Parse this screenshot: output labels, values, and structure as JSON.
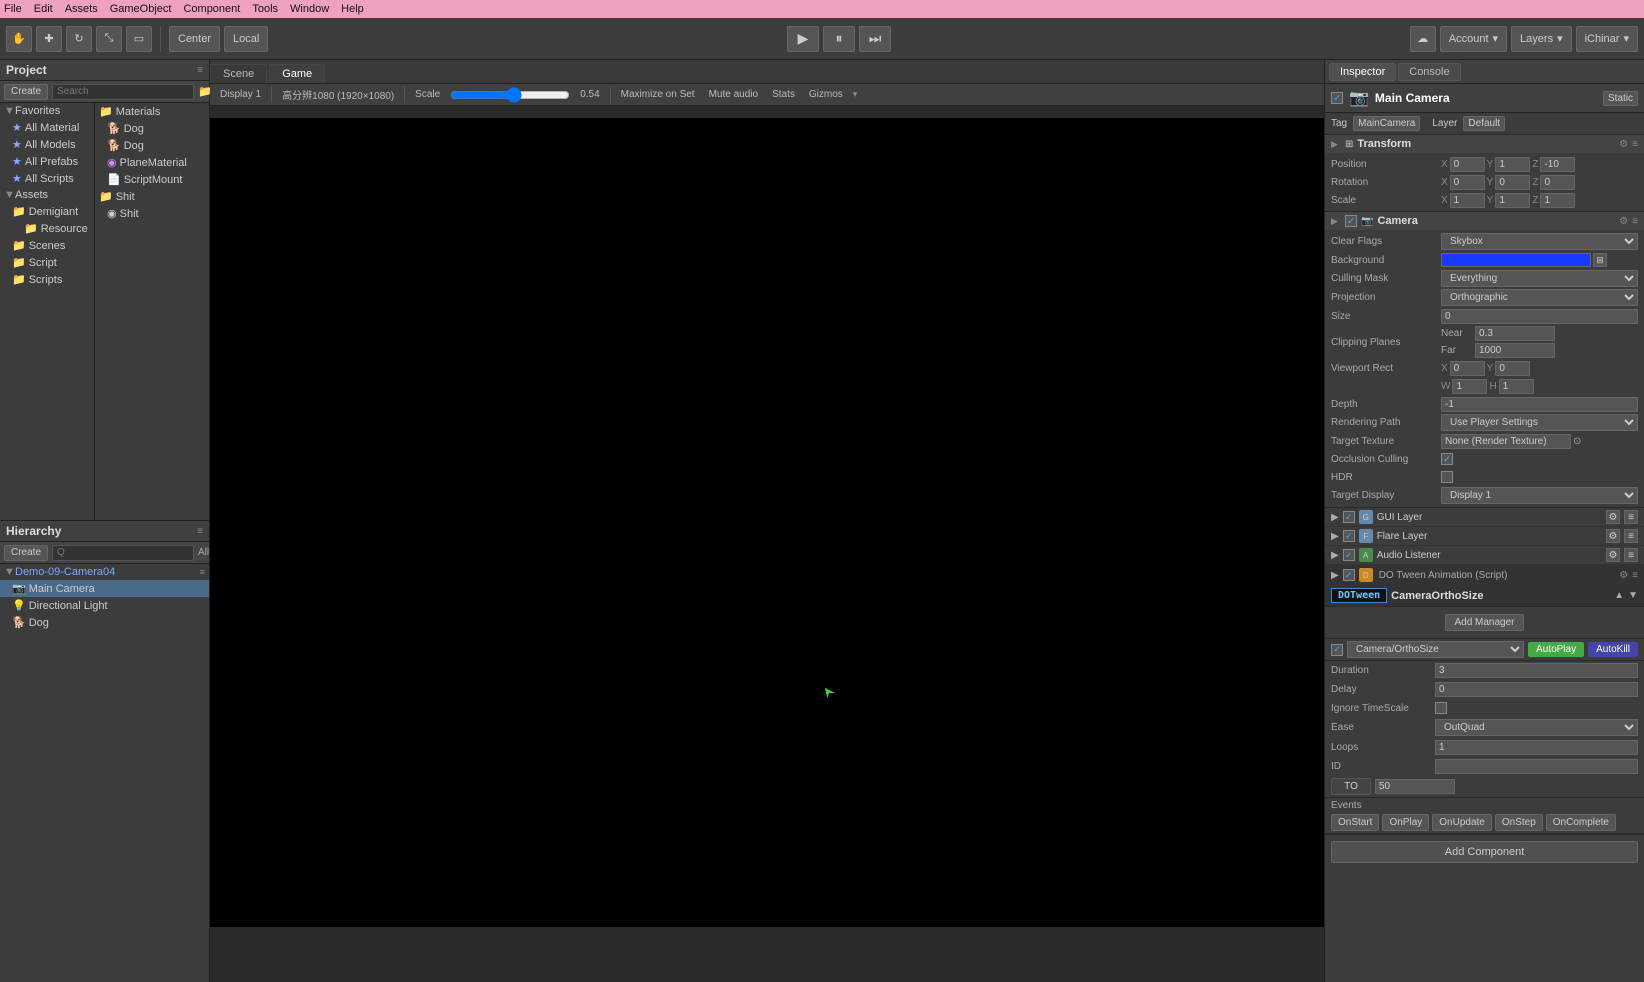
{
  "menu": {
    "items": [
      "File",
      "Edit",
      "Assets",
      "GameObject",
      "Component",
      "Tools",
      "Window",
      "Help"
    ]
  },
  "toolbar": {
    "pivot_label": "Center",
    "space_label": "Local",
    "account_label": "Account",
    "layers_label": "Layers",
    "iChinar_label": "iChinar"
  },
  "tabs": {
    "scene": "Scene",
    "game": "Game"
  },
  "game": {
    "display": "Display 1",
    "resolution": "高分辨1080 (1920×1080)",
    "scale_label": "Scale",
    "scale_value": "0.54",
    "maximize": "Maximize on Set",
    "mute": "Mute audio",
    "stats": "Stats",
    "gizmos": "Gizmos"
  },
  "project": {
    "title": "Project",
    "create_label": "Create",
    "search_placeholder": "Search"
  },
  "assets": {
    "favorites": {
      "label": "Favorites",
      "items": [
        "All Material",
        "All Models",
        "All Prefabs",
        "All Scripts"
      ]
    },
    "assets_root": {
      "label": "Assets",
      "items": [
        {
          "name": "Demigiant",
          "indent": 1
        },
        {
          "name": "Resource",
          "indent": 2
        },
        {
          "name": "Scenes",
          "indent": 2
        },
        {
          "name": "Script",
          "indent": 2
        },
        {
          "name": "Scripts",
          "indent": 2
        }
      ]
    },
    "resource": {
      "label": "Resource",
      "items": [
        {
          "name": "Materials",
          "indent": 0
        },
        {
          "name": "Dog",
          "indent": 1
        },
        {
          "name": "Dog",
          "indent": 1
        },
        {
          "name": "PlaneMaterial",
          "indent": 1
        },
        {
          "name": "ScriptMount",
          "indent": 1
        },
        {
          "name": "Shit",
          "indent": 0
        },
        {
          "name": "Shit",
          "indent": 1
        }
      ]
    }
  },
  "hierarchy": {
    "title": "Hierarchy",
    "create_label": "Create",
    "search_placeholder": "Q",
    "scene": "Demo-09-Camera04",
    "items": [
      {
        "name": "Main Camera",
        "indent": 1,
        "selected": true
      },
      {
        "name": "Directional Light",
        "indent": 1
      },
      {
        "name": "Dog",
        "indent": 1
      }
    ]
  },
  "inspector": {
    "tab_inspector": "Inspector",
    "tab_console": "Console",
    "object_name": "Main Camera",
    "static_label": "Static",
    "tag_label": "Tag",
    "tag_value": "MainCamera",
    "layer_label": "Layer",
    "layer_value": "Default",
    "transform": {
      "title": "Transform",
      "position": {
        "x": "0",
        "y": "1",
        "z": "-10"
      },
      "rotation": {
        "x": "0",
        "y": "0",
        "z": "0"
      },
      "scale": {
        "x": "1",
        "y": "1",
        "z": "1"
      }
    },
    "camera": {
      "title": "Camera",
      "clear_flags_label": "Clear Flags",
      "clear_flags_value": "Skybox",
      "background_label": "Background",
      "culling_mask_label": "Culling Mask",
      "culling_mask_value": "Everything",
      "projection_label": "Projection",
      "projection_value": "Orthographic",
      "size_label": "Size",
      "size_value": "0",
      "clipping_planes_label": "Clipping Planes",
      "near_label": "Near",
      "near_value": "0.3",
      "far_label": "Far",
      "far_value": "1000",
      "viewport_rect_label": "Viewport Rect",
      "vp_x": "0",
      "vp_y": "0",
      "vp_w": "1",
      "vp_h": "1",
      "depth_label": "Depth",
      "depth_value": "-1",
      "rendering_path_label": "Rendering Path",
      "rendering_path_value": "Use Player Settings",
      "target_texture_label": "Target Texture",
      "target_texture_value": "None (Render Texture)",
      "occlusion_culling_label": "Occlusion Culling",
      "hdr_label": "HDR",
      "target_display_label": "Target Display",
      "target_display_value": "Display 1"
    },
    "gui_layer": "GUI Layer",
    "flare_layer": "Flare Layer",
    "audio_listener": "Audio Listener",
    "dotween": {
      "title": "DO Tween Animation (Script)",
      "logo": "DOTween",
      "component_name": "CameraOrthoSize",
      "add_manager": "Add Manager",
      "prop_label": "Camera/OrthoSize",
      "autoplay": "AutoPlay",
      "autokill": "AutoKill",
      "duration_label": "Duration",
      "duration_value": "3",
      "delay_label": "Delay",
      "delay_value": "0",
      "ignore_timescale_label": "Ignore TimeScale",
      "ease_label": "Ease",
      "ease_value": "OutQuad",
      "loops_label": "Loops",
      "loops_value": "1",
      "id_label": "ID",
      "id_value": "",
      "to_label": "TO",
      "to_value": "50",
      "events_label": "Events",
      "event_buttons": [
        "OnStart",
        "OnPlay",
        "OnUpdate",
        "OnStep",
        "OnComplete"
      ]
    },
    "add_component": "Add Component"
  }
}
